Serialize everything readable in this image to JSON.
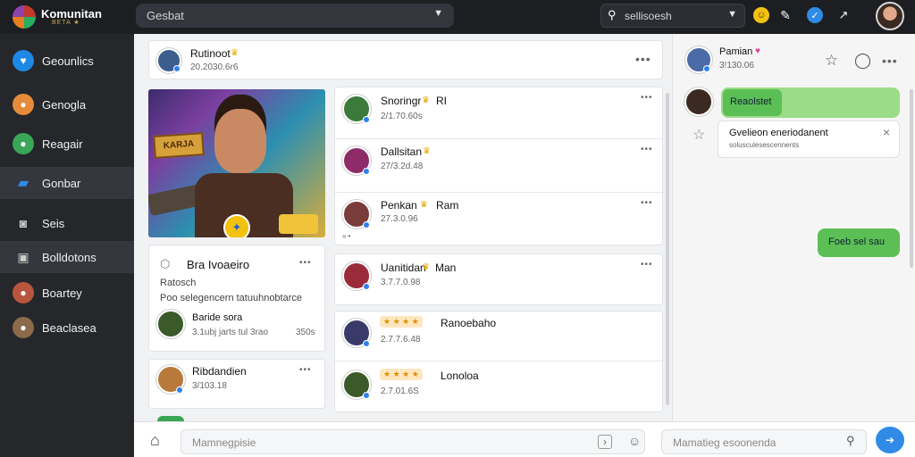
{
  "app": {
    "title": "Komunitan",
    "subtitle": "BETA ★"
  },
  "topbar": {
    "search_text": "Gesbat",
    "search2_text": "sellisoesh",
    "icons": [
      "emoji-icon",
      "pen-icon",
      "verified-icon",
      "trend-icon"
    ]
  },
  "sidebar": {
    "items": [
      {
        "label": "Geounlics",
        "icon": "heart-icon",
        "color": "#1e88e5"
      },
      {
        "label": "Genogla",
        "icon": "avatar-icon",
        "color": "#e58b3a"
      },
      {
        "label": "Reagair",
        "icon": "avatar-icon",
        "color": "#3aa657"
      },
      {
        "label": "Gonbar",
        "icon": "folder-icon",
        "color": "#2f8be6"
      },
      {
        "label": "Seis",
        "icon": "camera-icon",
        "color": "#777"
      },
      {
        "label": "Bolldotons",
        "icon": "panel-icon",
        "color": "#777"
      },
      {
        "label": "Boartey",
        "icon": "avatar-icon",
        "color": "#b8563d"
      },
      {
        "label": "Beaclasea",
        "icon": "avatar-icon",
        "color": "#8a6a4a"
      }
    ]
  },
  "post_header": {
    "name": "Rutinoot",
    "time": "20.2030.6r6"
  },
  "banner": {
    "sign_text": "KARJA"
  },
  "card_news": {
    "title": "Bra Ivoaeiro",
    "line1": "Ratosch",
    "line2": "Poo selegencern tatuuhnobtarce",
    "user_name": "Baride sora",
    "user_meta": "3.1ubj jarts tul 3rao",
    "user_meta_right": "350s"
  },
  "card_user2": {
    "name": "Ribdandien",
    "time": "3/103.18"
  },
  "feed": [
    {
      "name": "Snoringr",
      "tag": "RI",
      "time": "2/1.70.60s",
      "color": "#3b7a3b"
    },
    {
      "name": "Dallsitan",
      "tag": "",
      "time": "27/3.2d.48",
      "color": "#8e2c6a"
    },
    {
      "name": "Penkan",
      "tag": "Ram",
      "time": "27.3.0.96",
      "color": "#7a3b3b",
      "extra": "«∙•"
    },
    {
      "name": "Uanitidan",
      "tag": "Man",
      "time": "3.7.7.0.98",
      "color": "#9a2c3a"
    },
    {
      "name": "Ranoebaho",
      "tag": "",
      "time": "2.7.7.6.48",
      "color": "#3a3a6a",
      "stars": "★ ★ ★ ★"
    },
    {
      "name": "Lonoloa",
      "tag": "",
      "time": "2.7.01.6S",
      "color": "#3a5a2a",
      "stars": "★ ★ ★ ★"
    }
  ],
  "chat": {
    "header_name": "Pamian",
    "header_time": "3!130.06",
    "bubble1": "Reaolstet",
    "notice_title": "Gvelieon eneriodanent",
    "notice_sub": "solusculesescennents",
    "bubble2": "Foeb sel sau"
  },
  "bottom": {
    "input1_placeholder": "Mamnegpisie",
    "input2_placeholder": "Mamatieg esoonenda"
  }
}
